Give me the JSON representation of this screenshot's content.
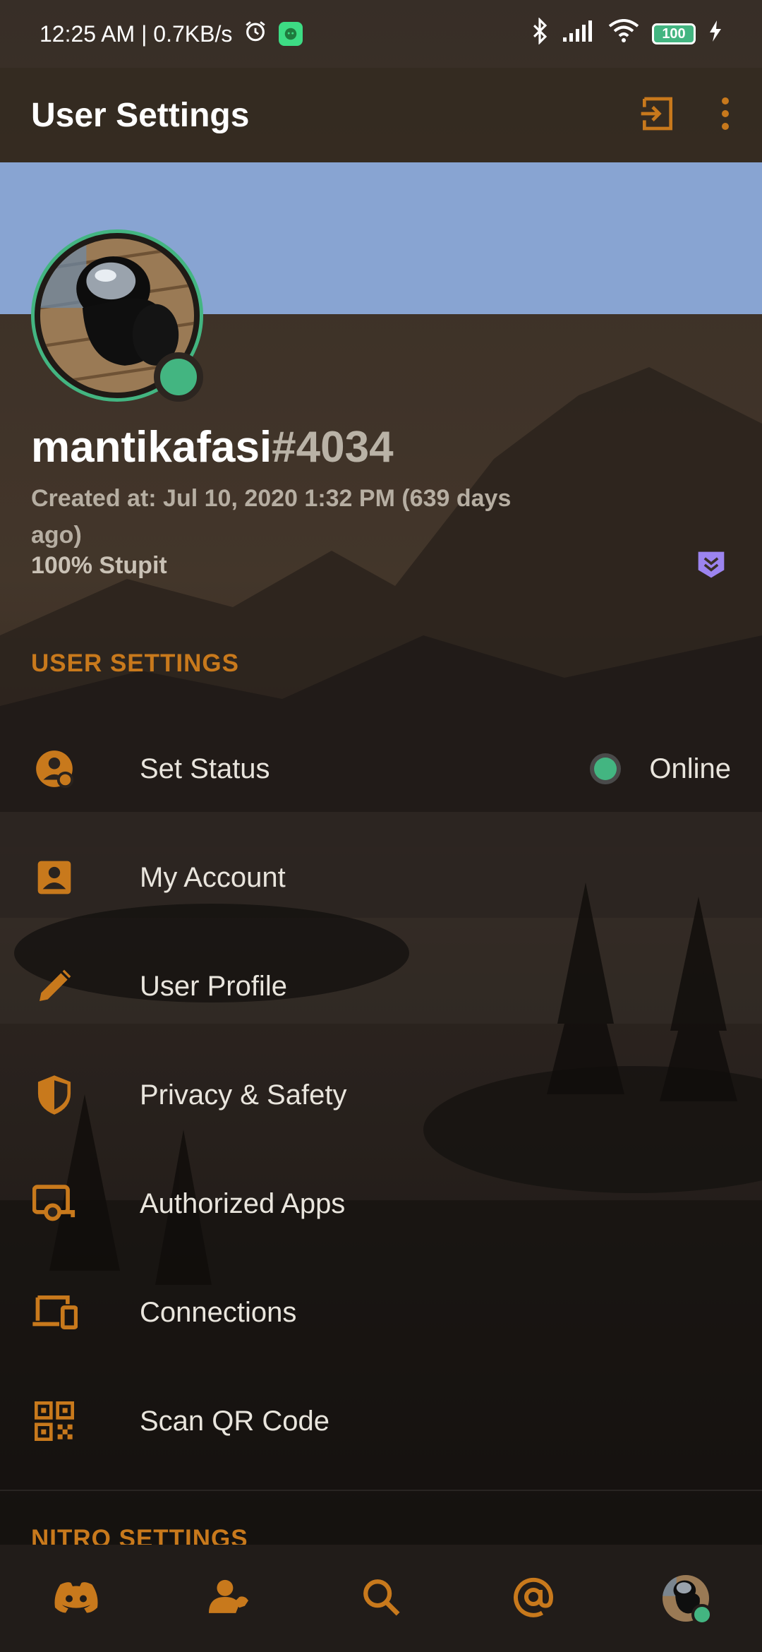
{
  "status_bar": {
    "time_speed": "12:25 AM | 0.7KB/s",
    "battery": "100"
  },
  "appbar": {
    "title": "User Settings"
  },
  "profile": {
    "username": "mantikafasi",
    "discriminator": "#4034",
    "created": "Created at: Jul 10, 2020 1:32 PM (639 days ago)",
    "about": "100% Stupit",
    "status_color": "#43b581",
    "banner_color": "#88a4d2"
  },
  "user_settings": {
    "header": "USER SETTINGS",
    "items": [
      {
        "label": "Set Status",
        "icon": "status-icon",
        "trailing": "Online"
      },
      {
        "label": "My Account",
        "icon": "account-icon"
      },
      {
        "label": "User Profile",
        "icon": "pencil-icon"
      },
      {
        "label": "Privacy & Safety",
        "icon": "shield-icon"
      },
      {
        "label": "Authorized Apps",
        "icon": "authorized-apps-icon"
      },
      {
        "label": "Connections",
        "icon": "devices-icon"
      },
      {
        "label": "Scan QR Code",
        "icon": "qr-code-icon"
      }
    ]
  },
  "nitro_settings": {
    "header": "NITRO SETTINGS"
  },
  "bottom_nav": {
    "items": [
      "discord-home-icon",
      "friends-icon",
      "search-icon",
      "mentions-icon",
      "profile-avatar"
    ]
  },
  "colors": {
    "accent": "#c8791c",
    "online": "#43b581"
  }
}
